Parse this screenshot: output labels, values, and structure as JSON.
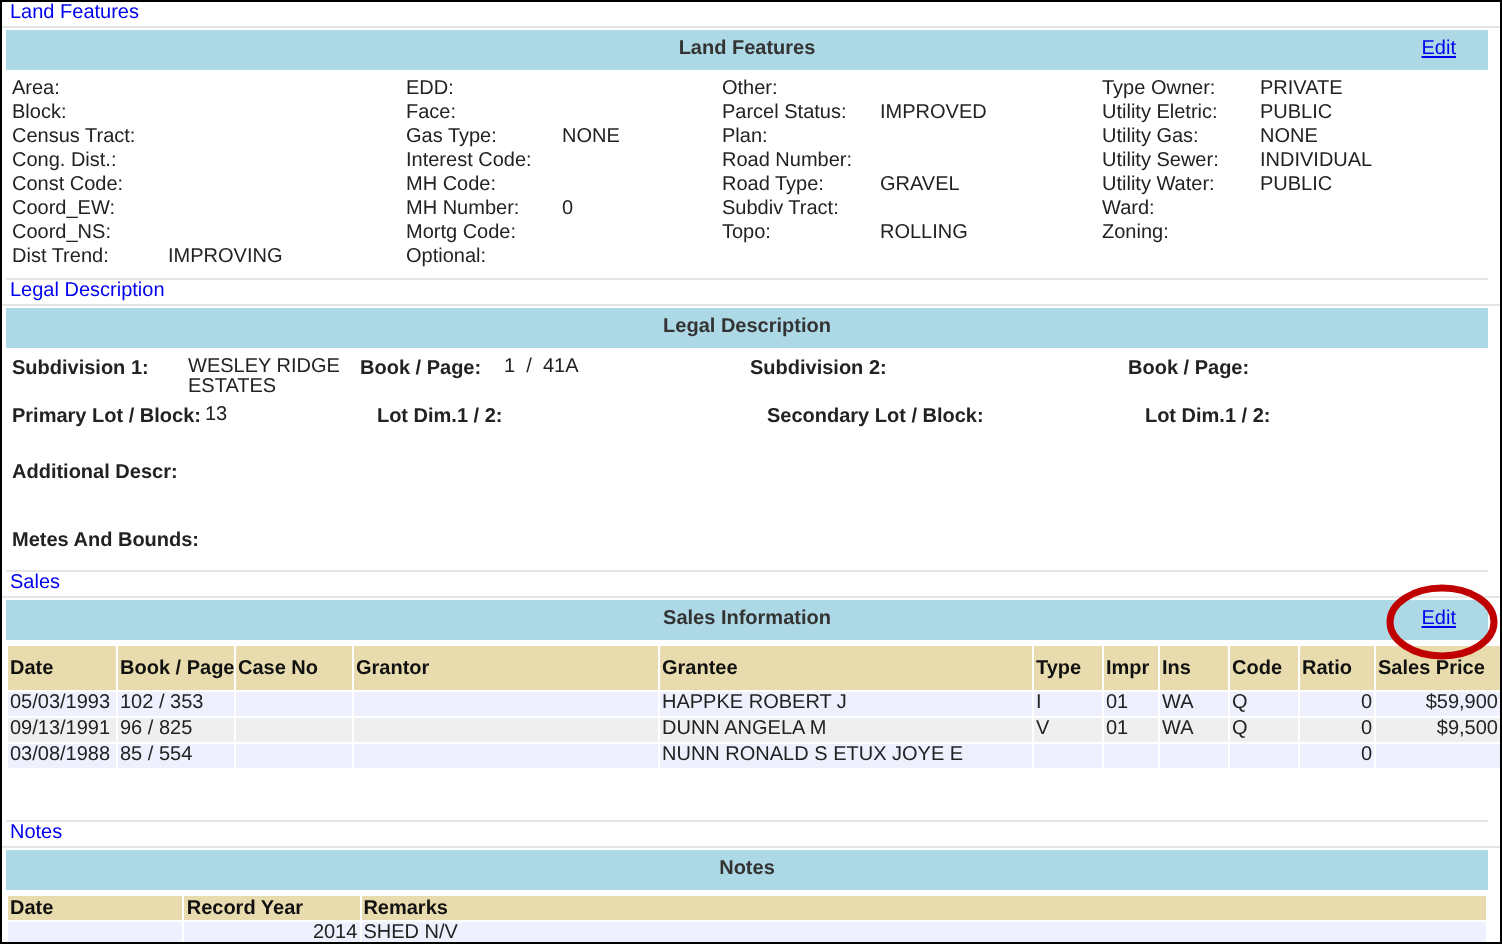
{
  "land_features": {
    "legend": "Land Features",
    "title": "Land Features",
    "edit": "Edit",
    "columns": [
      [
        {
          "label": "Area:"
        },
        {
          "label": "Block:"
        },
        {
          "label": "Census Tract:"
        },
        {
          "label": "Cong. Dist.:"
        },
        {
          "label": "Const Code:"
        },
        {
          "label": "Coord_EW:"
        },
        {
          "label": "Coord_NS:"
        },
        {
          "label": "Dist Trend:",
          "value": "IMPROVING"
        }
      ],
      [
        {
          "label": "EDD:"
        },
        {
          "label": "Face:"
        },
        {
          "label": "Gas Type:",
          "value": "NONE"
        },
        {
          "label": "Interest Code:"
        },
        {
          "label": "MH Code:"
        },
        {
          "label": "MH Number:",
          "value": "0"
        },
        {
          "label": "Mortg Code:"
        },
        {
          "label": "Optional:"
        }
      ],
      [
        {
          "label": "Other:"
        },
        {
          "label": "Parcel Status:",
          "value": "IMPROVED"
        },
        {
          "label": "Plan:"
        },
        {
          "label": "Road Number:"
        },
        {
          "label": "Road Type:",
          "value": "GRAVEL"
        },
        {
          "label": "Subdiv Tract:"
        },
        {
          "label": "Topo:",
          "value": "ROLLING"
        }
      ],
      [
        {
          "label": "Type Owner:",
          "value": "PRIVATE"
        },
        {
          "label": "Utility Eletric:",
          "value": "PUBLIC"
        },
        {
          "label": "Utility Gas:",
          "value": "NONE"
        },
        {
          "label": "Utility Sewer:",
          "value": "INDIVIDUAL"
        },
        {
          "label": "Utility Water:",
          "value": "PUBLIC"
        },
        {
          "label": "Ward:"
        },
        {
          "label": "Zoning:"
        }
      ]
    ]
  },
  "legal_description": {
    "legend": "Legal Description",
    "title": "Legal Description",
    "rows": [
      [
        {
          "label": "Subdivision 1:",
          "value": "WESLEY RIDGE ESTATES"
        },
        {
          "label": "Book / Page:",
          "value": "1  /  41A"
        },
        {
          "label": "Subdivision 2:"
        },
        {
          "label": "Book / Page:"
        }
      ],
      [
        {
          "label": "Primary Lot / Block:",
          "value": "13"
        },
        {
          "label": "Lot Dim.1 / 2:"
        },
        {
          "label": "Secondary Lot / Block:"
        },
        {
          "label": "Lot Dim.1 / 2:"
        }
      ],
      [
        {
          "label": "Additional Descr:"
        }
      ],
      [
        {
          "label": "Metes And Bounds:"
        }
      ]
    ]
  },
  "sales": {
    "legend": "Sales",
    "title": "Sales Information",
    "edit": "Edit",
    "edit_circled": true,
    "columns": [
      "Date",
      "Book / Page",
      "Case No",
      "Grantor",
      "Grantee",
      "Type",
      "Impr",
      "Ins",
      "Code",
      "Ratio",
      "Sales Price"
    ],
    "rows": [
      [
        "05/03/1993",
        "102 / 353",
        null,
        null,
        "HAPPKE ROBERT J",
        "I",
        "01",
        "WA",
        "Q",
        "0",
        "$59,900"
      ],
      [
        "09/13/1991",
        "96 / 825",
        null,
        null,
        "DUNN ANGELA M",
        "V",
        "01",
        "WA",
        "Q",
        "0",
        "$9,500"
      ],
      [
        "03/08/1988",
        "85 / 554",
        null,
        null,
        "NUNN RONALD S ETUX JOYE E",
        null,
        null,
        null,
        null,
        "0",
        null
      ]
    ]
  },
  "notes": {
    "legend": "Notes",
    "title": "Notes",
    "columns": [
      "Date",
      "Record Year",
      "Remarks"
    ],
    "rows": [
      [
        null,
        "2014",
        "SHED N/V"
      ]
    ]
  }
}
